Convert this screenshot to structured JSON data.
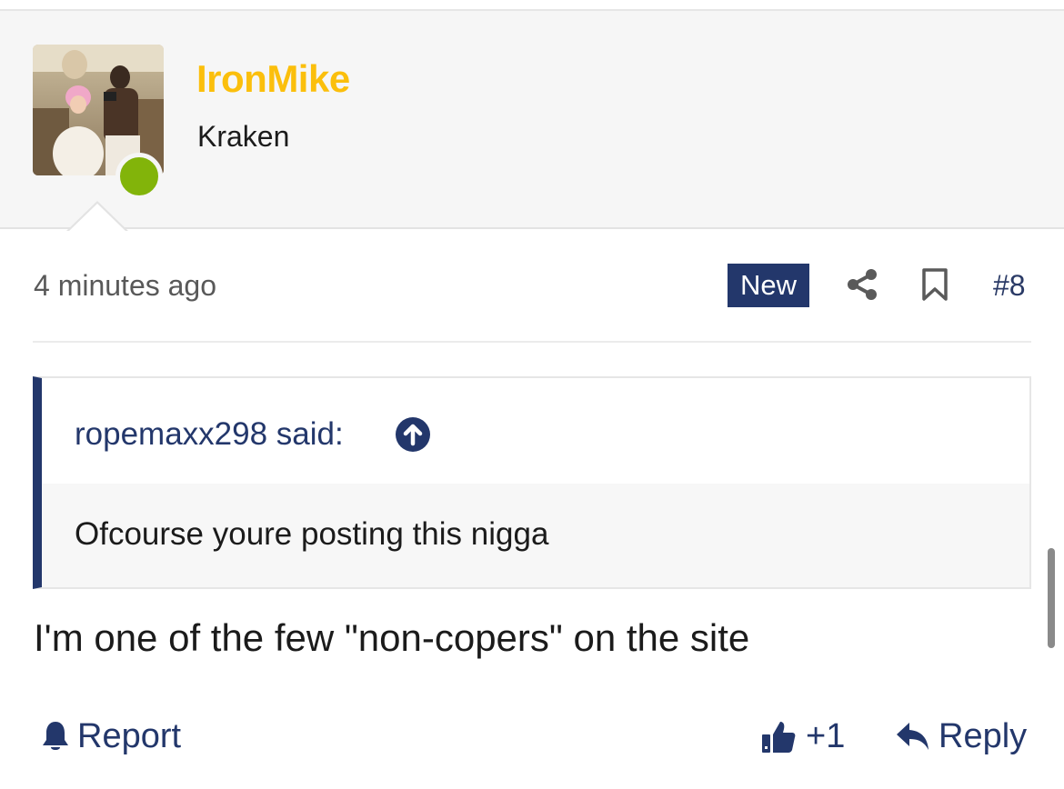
{
  "post": {
    "author": {
      "username": "IronMike",
      "title": "Kraken",
      "online": true,
      "avatar": "user-avatar-photo"
    },
    "timestamp": "4 minutes ago",
    "badge": "New",
    "number": "#8",
    "quote": {
      "author_label": "ropemaxx298 said:",
      "text": "Ofcourse youre posting this nigga"
    },
    "body": "I'm one of the few \"non-copers\" on the site",
    "actions": {
      "report_label": "Report",
      "like_count": "+1",
      "reply_label": "Reply"
    }
  },
  "colors": {
    "username": "#fbbf0c",
    "accent": "#23376b",
    "online": "#82b40a",
    "header_bg": "#f6f6f6"
  },
  "icons": [
    "share-icon",
    "bookmark-icon",
    "arrow-up-circle-icon",
    "bell-icon",
    "thumbs-up-icon",
    "reply-icon"
  ]
}
